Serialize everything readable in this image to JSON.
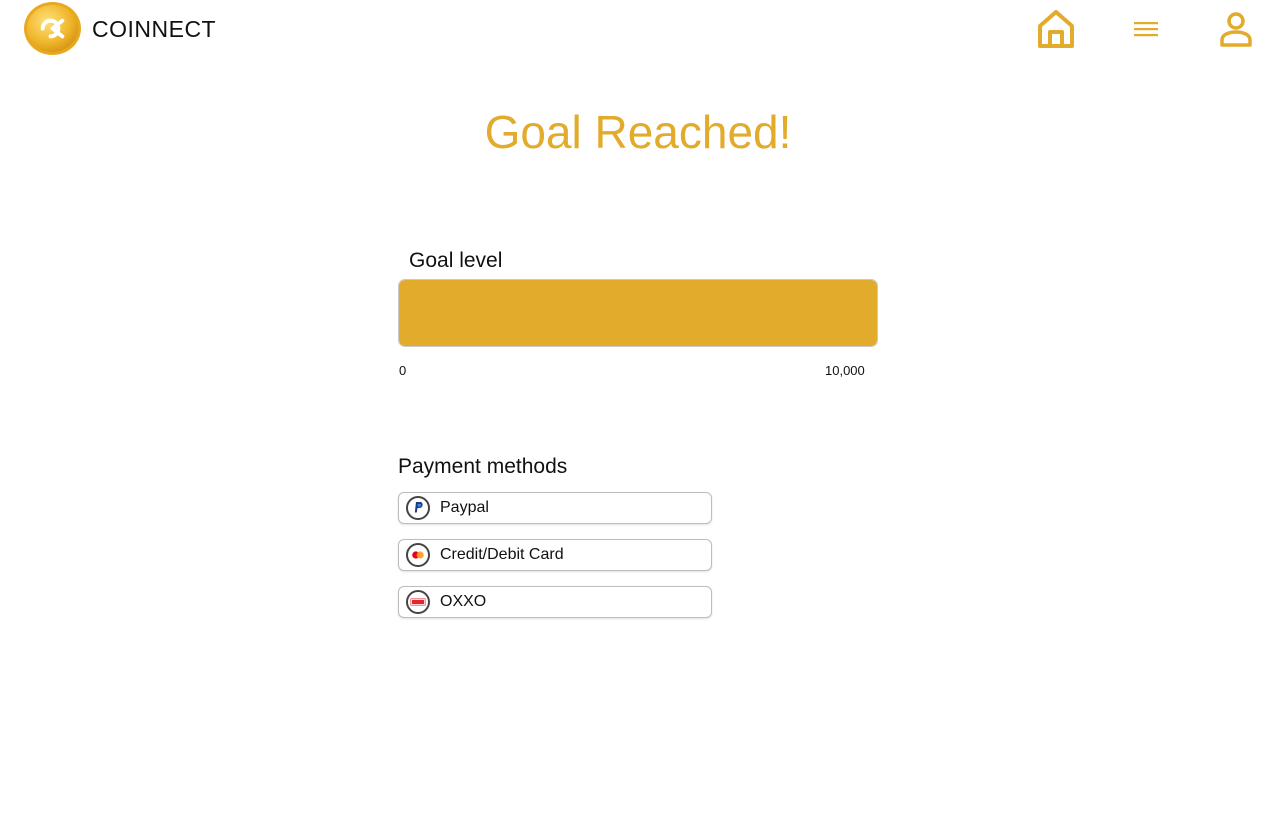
{
  "header": {
    "brand": "COINNECT",
    "logo_icon": "coinnect-coin-logo",
    "nav": [
      {
        "name": "home",
        "icon": "home-icon"
      },
      {
        "name": "menu",
        "icon": "hamburger-menu-icon"
      },
      {
        "name": "profile",
        "icon": "user-profile-icon"
      }
    ]
  },
  "main": {
    "title": "Goal Reached!",
    "goal": {
      "label": "Goal level",
      "min_label": "0",
      "max_label": "10,000",
      "progress_fraction": 1.0
    },
    "payment": {
      "heading": "Payment methods",
      "methods": [
        {
          "label": "Paypal",
          "icon": "paypal-icon"
        },
        {
          "label": "Credit/Debit Card",
          "icon": "credit-card-icon"
        },
        {
          "label": "OXXO",
          "icon": "oxxo-icon"
        }
      ]
    }
  },
  "colors": {
    "accent": "#e2ab2c",
    "text": "#111111",
    "border": "#bdbdbd"
  }
}
